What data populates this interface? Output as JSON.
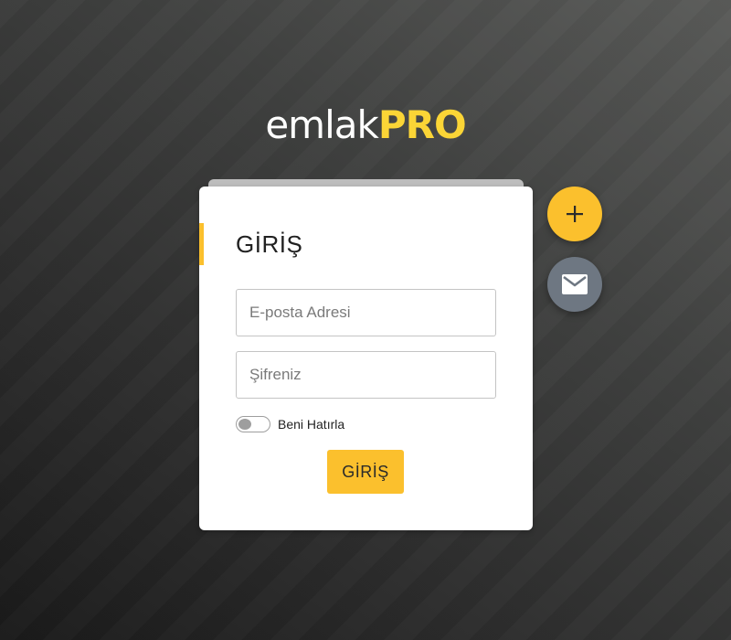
{
  "logo": {
    "light": "emlak",
    "accent": "PRO"
  },
  "login_card": {
    "title": "GİRİŞ",
    "email_placeholder": "E-posta Adresi",
    "password_placeholder": "Şifreniz",
    "remember_label": "Beni Hatırla",
    "remember_on": false,
    "submit_label": "GİRİŞ"
  },
  "fabs": [
    {
      "icon": "plus-icon"
    },
    {
      "icon": "mail-icon"
    }
  ],
  "colors": {
    "accent": "#fbc02d",
    "logo_accent": "#fbd536",
    "mail_fab": "#6e7782",
    "card": "#ffffff"
  }
}
